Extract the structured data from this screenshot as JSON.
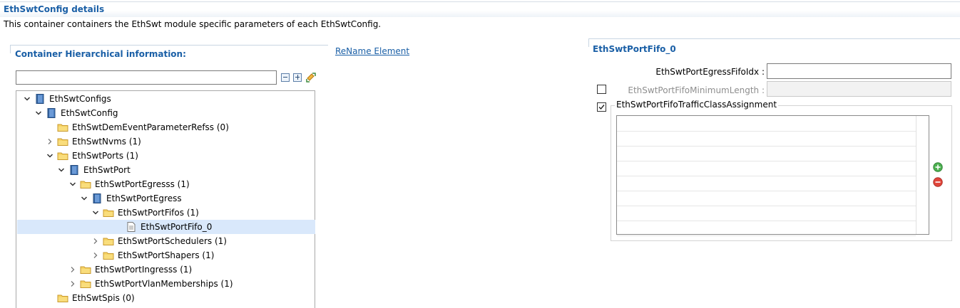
{
  "header": {
    "title": "EthSwtConfig details",
    "description": "This container containers the EthSwt module specific parameters of each EthSwtConfig."
  },
  "left_panel": {
    "section_title": "Container Hierarchical information:",
    "rename_link": "ReName Element",
    "filter_value": "",
    "tree": [
      {
        "label": "EthSwtConfigs",
        "expand": "expanded",
        "icon": "container-icon"
      },
      {
        "label": "EthSwtConfig",
        "expand": "expanded",
        "icon": "container-icon"
      },
      {
        "label": "EthSwtDemEventParameterRefss (0)",
        "expand": "none",
        "icon": "folder-icon"
      },
      {
        "label": "EthSwtNvms (1)",
        "expand": "collapsed",
        "icon": "folder-icon"
      },
      {
        "label": "EthSwtPorts (1)",
        "expand": "expanded",
        "icon": "folder-icon"
      },
      {
        "label": "EthSwtPort",
        "expand": "expanded",
        "icon": "container-icon"
      },
      {
        "label": "EthSwtPortEgresss (1)",
        "expand": "expanded",
        "icon": "folder-icon"
      },
      {
        "label": "EthSwtPortEgress",
        "expand": "expanded",
        "icon": "container-icon"
      },
      {
        "label": "EthSwtPortFifos (1)",
        "expand": "expanded",
        "icon": "folder-icon"
      },
      {
        "label": "EthSwtPortFifo_0",
        "expand": "none",
        "icon": "document-icon",
        "selected": true
      },
      {
        "label": "EthSwtPortSchedulers (1)",
        "expand": "collapsed",
        "icon": "folder-icon"
      },
      {
        "label": "EthSwtPortShapers (1)",
        "expand": "collapsed",
        "icon": "folder-icon"
      },
      {
        "label": "EthSwtPortIngresss (1)",
        "expand": "collapsed",
        "icon": "folder-icon"
      },
      {
        "label": "EthSwtPortVlanMemberships (1)",
        "expand": "collapsed",
        "icon": "folder-icon"
      },
      {
        "label": "EthSwtSpis (0)",
        "expand": "none",
        "icon": "folder-icon"
      }
    ]
  },
  "right_panel": {
    "title": "EthSwtPortFifo_0",
    "egress_fifo_idx_label": "EthSwtPortEgressFifoIdx :",
    "egress_fifo_idx_value": "",
    "min_length_label": "EthSwtPortFifoMinimumLength :",
    "min_length_value": "",
    "min_length_checked": false,
    "traffic_class_label": "EthSwtPortFifoTrafficClassAssignment",
    "traffic_class_checked": true,
    "traffic_class_rows": 8
  },
  "colors": {
    "accent": "#1a5fa6",
    "selection": "#d9e8fb",
    "folder": "#f2c94c",
    "container": "#3c6fb0",
    "add": "#4caf50",
    "remove": "#e0453a"
  }
}
